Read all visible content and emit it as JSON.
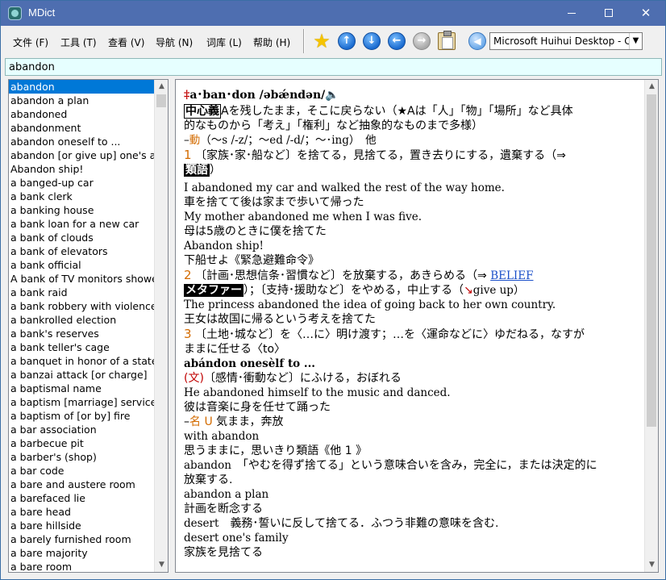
{
  "window": {
    "title": "MDict"
  },
  "menu": [
    {
      "label": "文件 (F)"
    },
    {
      "label": "工具 (T)"
    },
    {
      "label": "查看 (V)"
    },
    {
      "label": "导航 (N)"
    },
    {
      "label": "词库 (L)"
    },
    {
      "label": "帮助 (H)"
    }
  ],
  "toolbar": {
    "icons": [
      "star-icon",
      "arrow-up-icon",
      "arrow-down-icon",
      "arrow-left-icon",
      "arrow-right-icon",
      "clipboard-icon",
      "speaker-icon"
    ],
    "dictionary_selected": "Microsoft Huihui Desktop - C"
  },
  "search": {
    "value": "abandon"
  },
  "wordlist": {
    "selected_index": 0,
    "items": [
      "abandon",
      "abandon a plan",
      "abandoned",
      "abandonment",
      "abandon oneself to ...",
      "abandon [or give up] one's an",
      "Abandon ship!",
      "a banged-up car",
      "a bank clerk",
      "a banking house",
      "a bank loan for a new car",
      "a bank of clouds",
      "a bank of elevators",
      "a bank official",
      "A bank of TV monitors showe",
      "a bank raid",
      "a bank robbery with violence",
      "a bankrolled election",
      "a bank's reserves",
      "a bank teller's cage",
      "a banquet in honor of a state",
      "a banzai attack [or charge]",
      "a baptismal name",
      "a baptism [marriage] service",
      "a baptism of [or by] fire",
      "a bar association",
      "a barbecue pit",
      "a barber's (shop)",
      "a bar code",
      "a bare and austere room",
      "a barefaced lie",
      "a bare head",
      "a bare hillside",
      "a barely furnished room",
      "a bare majority",
      "a bare room"
    ]
  },
  "entry": {
    "head_mark": "‡",
    "headword": "a･ban･don /əbǽndən/",
    "core_tag": "中心義",
    "core_meaning": "Aを残したまま，そこに戻らない（★Aは「人」「物」「場所」など具体",
    "core_meaning2": "的なものから「考え」「権利」など抽象的なものまで多様）",
    "inflection_prefix": "–",
    "inflection_pos": "動",
    "inflection_text": "（～s /-z/；～ed /-d/；～･ing）　他",
    "sense1_num": "1",
    "sense1_text": "〔家族･家･船など〕を捨てる，見捨てる，置き去りにする，遺棄する（⇒",
    "sense1_tag": "類語",
    "sense1_close": "）",
    "ex1_en": "I abandoned my car and walked the rest of the way home.",
    "ex1_jp": "車を捨てて後は家まで歩いて帰った",
    "ex2_en": "My mother abandoned me when I was five.",
    "ex2_jp": "母は5歳のときに僕を捨てた",
    "ex3_en": "Abandon ship!",
    "ex3_jp": "下船せよ《緊急避難命令》",
    "sense2_num": "2",
    "sense2_text": "〔計画･思想信条･習慣など〕を放棄する，あきらめる（⇒",
    "sense2_link": "BELIEF",
    "sense2_tag": "メタファー",
    "sense2_text2": "）；〔支持･援助など〕をやめる，中止する（",
    "sense2_mark": "↘",
    "sense2_text3": "give up）",
    "ex4_en": "The princess abandoned the idea of going back to her own country.",
    "ex4_jp": "王女は故国に帰るという考えを捨てた",
    "sense3_num": "3",
    "sense3_text": "〔土地･城など〕を〈…に〉明け渡す；…を〈運命などに〉ゆだねる，なすが",
    "sense3_text2": "ままに任せる〈to〉",
    "phrase1": "abándon onesèlf to ...",
    "phrase1_mark": "(文)",
    "phrase1_text": "〔感情･衝動など〕にふける，おぼれる",
    "ex5_en": "He abandoned himself to the music and danced.",
    "ex5_jp": "彼は音楽に身を任せて踊った",
    "noun_prefix": "–",
    "noun_pos": "名",
    "noun_mark": "U",
    "noun_text": "気まま，奔放",
    "ex6_en": "with abandon",
    "ex6_jp": "思うままに，思いきり類語《他 1 》",
    "syn1_en": "abandon",
    "syn1_jp": "「やむを得ず捨てる」という意味合いを含み，完全に，または決定的に",
    "syn1_jp2": "放棄する.",
    "ex7_en": "abandon a plan",
    "ex7_jp": "計画を断念する",
    "syn2_en": "desert",
    "syn2_jp": "義務･誓いに反して捨てる．ふつう非難の意味を含む.",
    "ex8_en": "desert one's family",
    "ex8_jp": "家族を見捨てる"
  }
}
